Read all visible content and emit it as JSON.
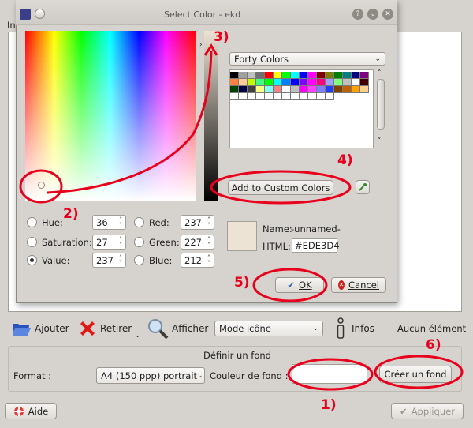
{
  "dialog": {
    "title": "Select Color - ekd",
    "color_mode_labels": [
      "Hue:",
      "Saturation:",
      "Value:",
      "Red:",
      "Green:",
      "Blue:"
    ],
    "values": {
      "hue": "36",
      "saturation": "27",
      "value": "237",
      "red": "237",
      "green": "227",
      "blue": "212"
    },
    "palette_name": "Forty Colors",
    "add_custom": "Add to Custom Colors",
    "name_label": "Name:",
    "name_value": "-unnamed-",
    "html_label": "HTML:",
    "html_value": "#EDE3D4",
    "ok": "OK",
    "cancel": "Cancel",
    "current_color": "#ede3d4",
    "palette": [
      "#000000",
      "#a0a0a0",
      "#c0c0c0",
      "#707070",
      "#ff0000",
      "#ffff00",
      "#00ff00",
      "#00ffff",
      "#0000ff",
      "#ff00ff",
      "#800000",
      "#808000",
      "#008000",
      "#008080",
      "#000080",
      "#800080",
      "#ff8040",
      "#ffcc99",
      "#c0ff00",
      "#40ff80",
      "#00ff00",
      "#00ffff",
      "#0080ff",
      "#0000ff",
      "#8000ff",
      "#ff00ff",
      "#ff0080",
      "#a0a0ff",
      "#80ff80",
      "#c0c0c0",
      "#ffffff",
      "#400000",
      "#004000",
      "#000040",
      "#404040",
      "#ffff80",
      "#80ffff",
      "#ff8080",
      "#ffffff",
      "#c0c0c0",
      "#ff00ff",
      "#ff40ff",
      "#8080ff",
      "#2040ff",
      "#804000",
      "#c06000",
      "#ffa000",
      "#ffd090",
      "#ffffff",
      "#ffffff",
      "#ffffff",
      "#ffffff",
      "#ffffff",
      "#ffffff",
      "#ffffff",
      "#ffffff",
      "#ffffff",
      "#ffffff",
      "#ffffff",
      "#ffffff"
    ]
  },
  "main": {
    "tab_fragment": "In",
    "add": "Ajouter",
    "remove": "Retirer",
    "show": "Afficher",
    "view_mode": "Mode icône",
    "info": "Infos",
    "no_element": "Aucun élément",
    "bg_title": "Définir un fond",
    "format_label": "Format :",
    "format_value": "A4 (150 ppp) portrait",
    "bg_color_label": "Couleur de fond :",
    "create_bg": "Créer un fond",
    "help": "Aide",
    "apply": "Appliquer"
  },
  "annotations": [
    "1)",
    "2)",
    "3)",
    "4)",
    "5)",
    "6)"
  ]
}
